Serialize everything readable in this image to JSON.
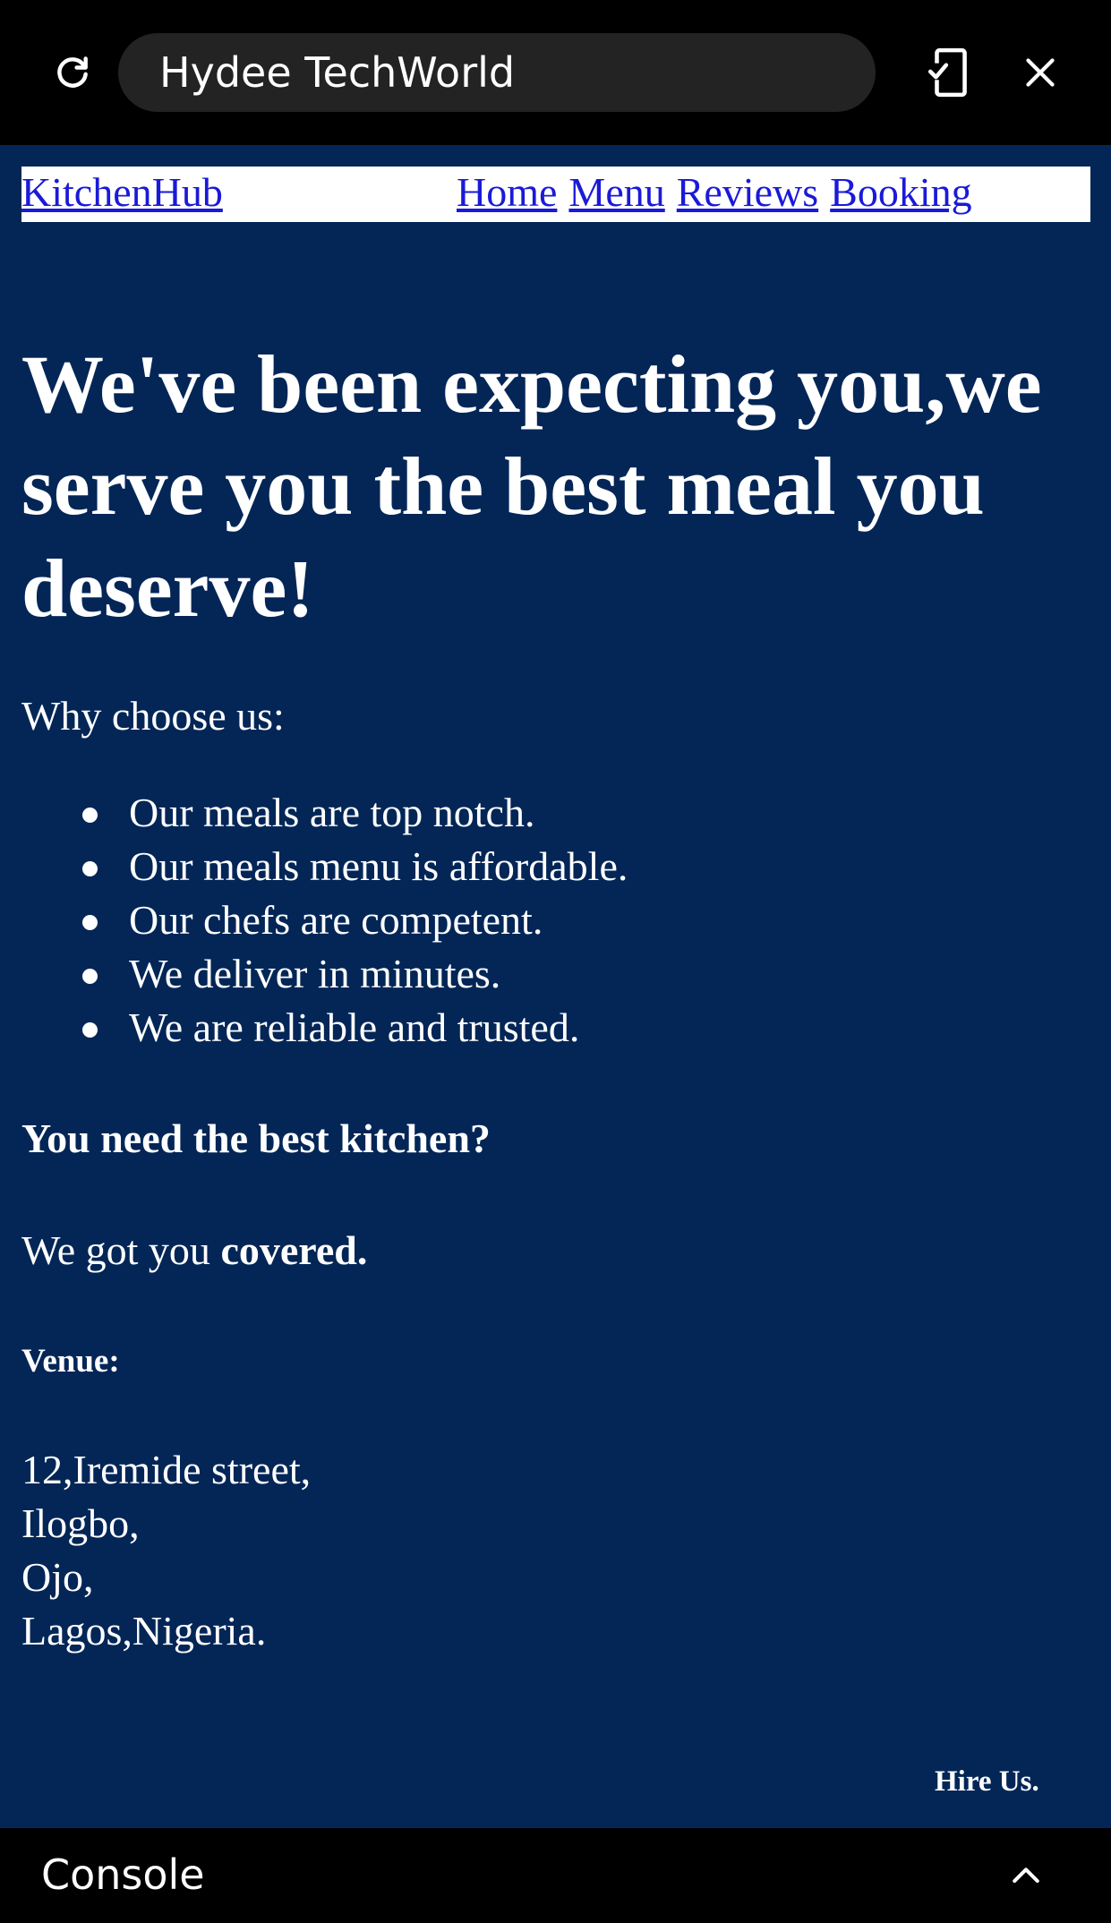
{
  "browser": {
    "title": "Hydee TechWorld",
    "icons": {
      "reload": "reload-icon",
      "device": "device-mode-icon",
      "close": "close-icon"
    }
  },
  "site": {
    "brand": "KitchenHub",
    "nav": [
      "Home",
      "Menu",
      "Reviews",
      "Booking"
    ],
    "hero": "We've been expecting you,we serve you the best meal you deserve!",
    "why_label": "Why choose us:",
    "reasons": [
      "Our meals are top notch.",
      "Our meals menu is affordable.",
      "Our chefs are competent.",
      "We deliver in minutes.",
      "We are reliable and trusted."
    ],
    "need_text": "You need the best kitchen?",
    "covered_prefix": "We got you ",
    "covered_bold": "covered.",
    "venue_label": "Venue:",
    "address": [
      "12,Iremide street,",
      "Ilogbo,",
      "Ojo,",
      "Lagos,Nigeria."
    ],
    "hire": "Hire Us."
  },
  "console": {
    "label": "Console",
    "toggle_icon": "chevron-up-icon"
  },
  "colors": {
    "page_background": "#032657",
    "link": "#1a1ad8",
    "chrome": "#000000",
    "urlbar": "#232323"
  }
}
